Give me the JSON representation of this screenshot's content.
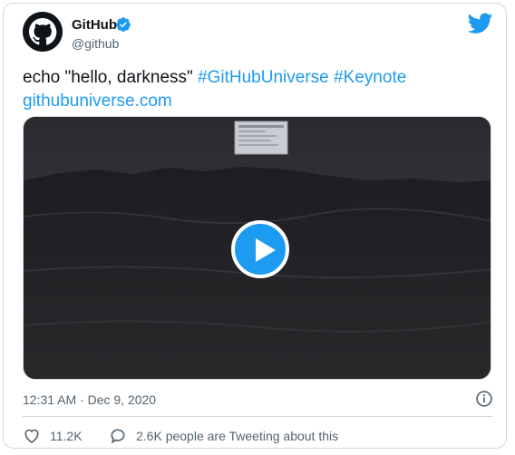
{
  "tweet": {
    "author_name": "GitHub",
    "author_handle": "@github",
    "text_plain": "echo \"hello, darkness\"",
    "hashtags": [
      "#GitHubUniverse",
      "#Keynote"
    ],
    "link": "githubuniverse.com",
    "timestamp": "12:31 AM · Dec 9, 2020",
    "likes": "11.2K",
    "conversation": "2.6K people are Tweeting about this"
  },
  "icons": {
    "avatar": "github-octocat-icon",
    "verified": "verified-badge-icon",
    "brand": "twitter-bird-icon",
    "play": "play-icon",
    "info": "info-icon",
    "like": "heart-icon",
    "reply": "speech-bubble-icon"
  },
  "colors": {
    "link": "#1d9bf0",
    "text": "#0f1419",
    "muted": "#536471",
    "video_bg": "#2a292c"
  }
}
